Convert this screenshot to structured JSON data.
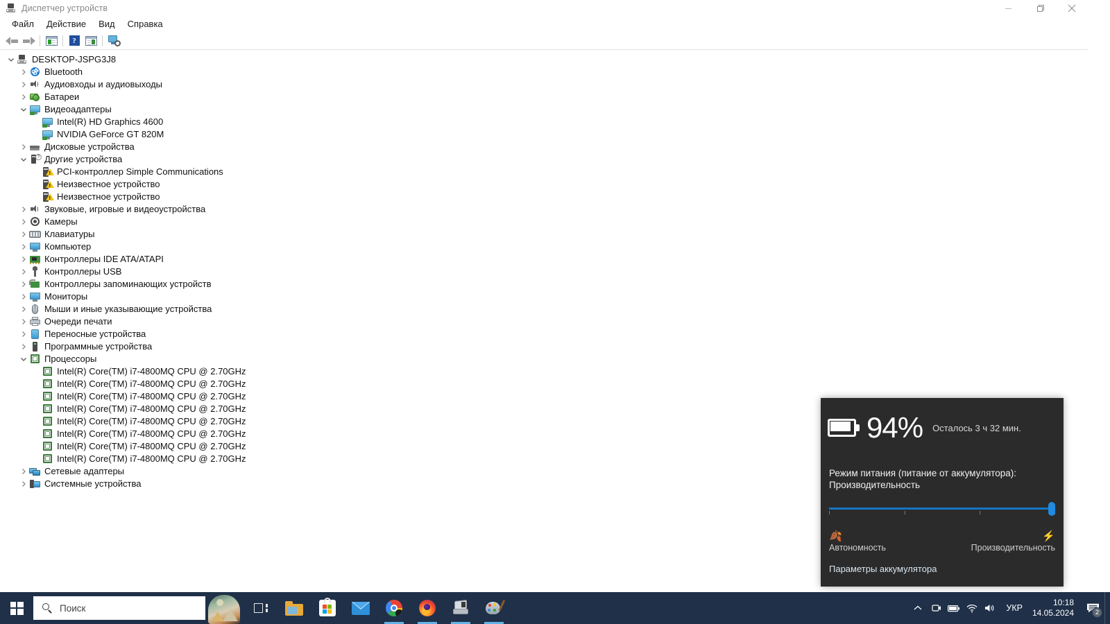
{
  "window": {
    "title": "Диспетчер устройств",
    "title_icon": "device-manager-icon",
    "controls": {
      "minimize": "minimize-icon",
      "maximize": "maximize-icon",
      "close": "close-icon"
    }
  },
  "menubar": {
    "items": [
      {
        "label": "Файл",
        "name": "menu-file"
      },
      {
        "label": "Действие",
        "name": "menu-action"
      },
      {
        "label": "Вид",
        "name": "menu-view"
      },
      {
        "label": "Справка",
        "name": "menu-help"
      }
    ]
  },
  "toolbar": {
    "buttons": [
      {
        "name": "back-button",
        "icon": "arrow-left-icon"
      },
      {
        "name": "forward-button",
        "icon": "arrow-right-icon"
      },
      {
        "name": "properties-button",
        "icon": "properties-window-icon"
      },
      {
        "name": "help-button",
        "icon": "help-question-icon"
      },
      {
        "name": "show-hidden-button",
        "icon": "window-list-icon"
      },
      {
        "name": "scan-hardware-button",
        "icon": "scan-monitor-icon"
      }
    ]
  },
  "tree": {
    "root": {
      "label": "DESKTOP-JSPG3J8",
      "icon": "computer-root-icon",
      "expanded": true
    },
    "nodes": [
      {
        "label": "Bluetooth",
        "icon": "bluetooth-icon",
        "level": 1,
        "expanded": false,
        "has_children": true
      },
      {
        "label": "Аудиовходы и аудиовыходы",
        "icon": "speaker-icon",
        "level": 1,
        "expanded": false,
        "has_children": true
      },
      {
        "label": "Батареи",
        "icon": "battery-icon",
        "level": 1,
        "expanded": false,
        "has_children": true
      },
      {
        "label": "Видеоадаптеры",
        "icon": "display-adapter-icon",
        "level": 1,
        "expanded": true,
        "has_children": true
      },
      {
        "label": "Intel(R) HD Graphics 4600",
        "icon": "display-adapter-icon",
        "level": 2,
        "expanded": false,
        "has_children": false
      },
      {
        "label": "NVIDIA GeForce GT 820M",
        "icon": "display-adapter-icon",
        "level": 2,
        "expanded": false,
        "has_children": false
      },
      {
        "label": "Дисковые устройства",
        "icon": "disk-drive-icon",
        "level": 1,
        "expanded": false,
        "has_children": true
      },
      {
        "label": "Другие устройства",
        "icon": "other-device-icon",
        "level": 1,
        "expanded": true,
        "has_children": true
      },
      {
        "label": "PCI-контроллер Simple Communications",
        "icon": "warning-device-icon",
        "level": 2,
        "expanded": false,
        "has_children": false
      },
      {
        "label": "Неизвестное устройство",
        "icon": "warning-device-icon",
        "level": 2,
        "expanded": false,
        "has_children": false
      },
      {
        "label": "Неизвестное устройство",
        "icon": "warning-device-icon",
        "level": 2,
        "expanded": false,
        "has_children": false
      },
      {
        "label": "Звуковые, игровые и видеоустройства",
        "icon": "speaker-icon",
        "level": 1,
        "expanded": false,
        "has_children": true
      },
      {
        "label": "Камеры",
        "icon": "camera-icon",
        "level": 1,
        "expanded": false,
        "has_children": true
      },
      {
        "label": "Клавиатуры",
        "icon": "keyboard-icon",
        "level": 1,
        "expanded": false,
        "has_children": true
      },
      {
        "label": "Компьютер",
        "icon": "monitor-icon",
        "level": 1,
        "expanded": false,
        "has_children": true
      },
      {
        "label": "Контроллеры IDE ATA/ATAPI",
        "icon": "ide-controller-icon",
        "level": 1,
        "expanded": false,
        "has_children": true
      },
      {
        "label": "Контроллеры USB",
        "icon": "usb-icon",
        "level": 1,
        "expanded": false,
        "has_children": true
      },
      {
        "label": "Контроллеры запоминающих устройств",
        "icon": "storage-controller-icon",
        "level": 1,
        "expanded": false,
        "has_children": true
      },
      {
        "label": "Мониторы",
        "icon": "monitor-icon",
        "level": 1,
        "expanded": false,
        "has_children": true
      },
      {
        "label": "Мыши и иные указывающие устройства",
        "icon": "mouse-icon",
        "level": 1,
        "expanded": false,
        "has_children": true
      },
      {
        "label": "Очереди печати",
        "icon": "printer-icon",
        "level": 1,
        "expanded": false,
        "has_children": true
      },
      {
        "label": "Переносные устройства",
        "icon": "portable-device-icon",
        "level": 1,
        "expanded": false,
        "has_children": true
      },
      {
        "label": "Программные устройства",
        "icon": "software-device-icon",
        "level": 1,
        "expanded": false,
        "has_children": true
      },
      {
        "label": "Процессоры",
        "icon": "processor-icon",
        "level": 1,
        "expanded": true,
        "has_children": true
      },
      {
        "label": "Intel(R) Core(TM) i7-4800MQ CPU @ 2.70GHz",
        "icon": "processor-icon",
        "level": 2,
        "expanded": false,
        "has_children": false
      },
      {
        "label": "Intel(R) Core(TM) i7-4800MQ CPU @ 2.70GHz",
        "icon": "processor-icon",
        "level": 2,
        "expanded": false,
        "has_children": false
      },
      {
        "label": "Intel(R) Core(TM) i7-4800MQ CPU @ 2.70GHz",
        "icon": "processor-icon",
        "level": 2,
        "expanded": false,
        "has_children": false
      },
      {
        "label": "Intel(R) Core(TM) i7-4800MQ CPU @ 2.70GHz",
        "icon": "processor-icon",
        "level": 2,
        "expanded": false,
        "has_children": false
      },
      {
        "label": "Intel(R) Core(TM) i7-4800MQ CPU @ 2.70GHz",
        "icon": "processor-icon",
        "level": 2,
        "expanded": false,
        "has_children": false
      },
      {
        "label": "Intel(R) Core(TM) i7-4800MQ CPU @ 2.70GHz",
        "icon": "processor-icon",
        "level": 2,
        "expanded": false,
        "has_children": false
      },
      {
        "label": "Intel(R) Core(TM) i7-4800MQ CPU @ 2.70GHz",
        "icon": "processor-icon",
        "level": 2,
        "expanded": false,
        "has_children": false
      },
      {
        "label": "Intel(R) Core(TM) i7-4800MQ CPU @ 2.70GHz",
        "icon": "processor-icon",
        "level": 2,
        "expanded": false,
        "has_children": false
      },
      {
        "label": "Сетевые адаптеры",
        "icon": "network-adapter-icon",
        "level": 1,
        "expanded": false,
        "has_children": true
      },
      {
        "label": "Системные устройства",
        "icon": "system-device-icon",
        "level": 1,
        "expanded": false,
        "has_children": true
      }
    ]
  },
  "battery_flyout": {
    "percent": "94%",
    "remaining": "Осталось 3 ч 32 мин.",
    "mode_label": "Режим питания (питание от аккумулятора):",
    "mode_value": "Производительность",
    "slider": {
      "value": 100,
      "ticks": 4
    },
    "left_icon": "leaf-icon",
    "right_icon": "lightning-icon",
    "left_label": "Автономность",
    "right_label": "Производительность",
    "settings_link": "Параметры аккумулятора",
    "accent_color": "#1476c6",
    "background_color": "#2b2b2b"
  },
  "taskbar": {
    "start": "windows-start-icon",
    "search": {
      "placeholder": "Поиск",
      "icon": "search-icon"
    },
    "cortana_image": "bing-wallpaper-thumbnail",
    "taskview": "task-view-icon",
    "apps": [
      {
        "name": "taskbar-file-explorer",
        "icon": "folder-icon",
        "active": false
      },
      {
        "name": "taskbar-microsoft-store",
        "icon": "store-icon",
        "active": false
      },
      {
        "name": "taskbar-mail",
        "icon": "mail-icon",
        "active": false
      },
      {
        "name": "taskbar-chrome",
        "icon": "chrome-icon",
        "active": true
      },
      {
        "name": "taskbar-firefox",
        "icon": "firefox-icon",
        "active": true
      },
      {
        "name": "taskbar-device-manager",
        "icon": "device-manager-icon",
        "active": true
      },
      {
        "name": "taskbar-paint",
        "icon": "paint-icon",
        "active": true
      }
    ],
    "tray": {
      "chevron": "chevron-up-icon",
      "icons": [
        {
          "name": "tray-camera-privacy",
          "icon": "camera-privacy-icon",
          "glyph": "▣"
        },
        {
          "name": "tray-battery",
          "icon": "battery-icon",
          "glyph": "▭"
        },
        {
          "name": "tray-network",
          "icon": "wifi-icon",
          "glyph": "◗"
        },
        {
          "name": "tray-volume",
          "icon": "speaker-icon",
          "glyph": "◀"
        }
      ],
      "language": "УКР",
      "time": "10:18",
      "date": "14.05.2024",
      "notifications": {
        "icon": "notification-icon",
        "count": "2"
      }
    }
  }
}
